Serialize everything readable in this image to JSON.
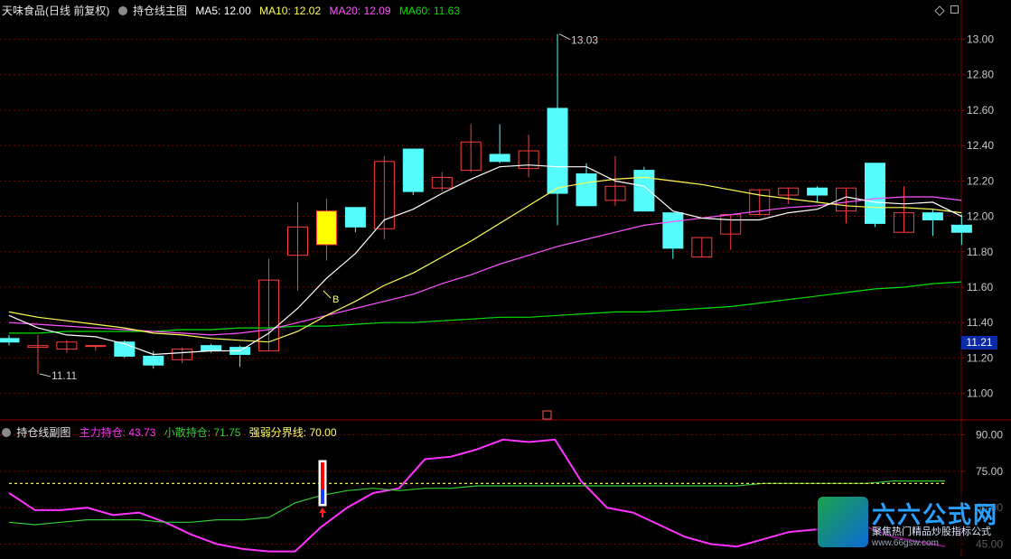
{
  "main_header": {
    "stock_name": "天味食品(日线 前复权)",
    "indicator_name": "持仓线主图",
    "ma5": "MA5: 12.00",
    "ma10": "MA10: 12.02",
    "ma20": "MA20: 12.09",
    "ma60": "MA60: 11.63"
  },
  "sub_header": {
    "indicator_name": "持仓线副图",
    "main_holding": "主力持仓: 43.73",
    "retail_holding": "小散持仓: 71.75",
    "boundary": "强弱分界线: 70.00"
  },
  "colors": {
    "up": "#ff3c3c",
    "down": "#54fcfc",
    "ma5": "#ffffff",
    "ma10": "#ffff54",
    "ma20": "#ff54ff",
    "ma60": "#00e000",
    "grid": "#7a0000",
    "axis_text": "#c8c8c8",
    "main_holding_line": "#ff33ff",
    "retail_holding_line": "#33cc33",
    "boundary_line": "#ffff66"
  },
  "price_axis": {
    "ticks": [
      "13.00",
      "12.80",
      "12.60",
      "12.40",
      "12.20",
      "12.00",
      "11.80",
      "11.60",
      "11.40",
      "11.20",
      "11.00"
    ],
    "current_price": "11.21"
  },
  "sub_axis": {
    "ticks": [
      "90.00",
      "75.00",
      "60.00",
      "45.00"
    ]
  },
  "annotations": {
    "high_label": "13.03",
    "low_label": "11.11",
    "buy_signal": "B"
  },
  "watermark": {
    "title": "六六公式网",
    "subtitle": "聚焦热门精品炒股指标公式",
    "url": "www.66gsw.com"
  },
  "chart_data": [
    {
      "type": "candlestick",
      "title": "持仓线主图",
      "ylim": [
        10.85,
        13.12
      ],
      "candles": [
        {
          "o": 11.31,
          "h": 11.33,
          "l": 11.27,
          "c": 11.29
        },
        {
          "o": 11.26,
          "h": 11.33,
          "l": 11.11,
          "c": 11.27
        },
        {
          "o": 11.25,
          "h": 11.3,
          "l": 11.23,
          "c": 11.29
        },
        {
          "o": 11.27,
          "h": 11.27,
          "l": 11.24,
          "c": 11.27
        },
        {
          "o": 11.29,
          "h": 11.3,
          "l": 11.2,
          "c": 11.21
        },
        {
          "o": 11.21,
          "h": 11.24,
          "l": 11.14,
          "c": 11.16
        },
        {
          "o": 11.19,
          "h": 11.26,
          "l": 11.17,
          "c": 11.25
        },
        {
          "o": 11.27,
          "h": 11.28,
          "l": 11.23,
          "c": 11.24
        },
        {
          "o": 11.26,
          "h": 11.27,
          "l": 11.15,
          "c": 11.22
        },
        {
          "o": 11.24,
          "h": 11.76,
          "l": 11.24,
          "c": 11.64
        },
        {
          "o": 11.78,
          "h": 12.08,
          "l": 11.58,
          "c": 11.94
        },
        {
          "o": 11.84,
          "h": 12.1,
          "l": 11.75,
          "c": 12.03
        },
        {
          "o": 12.05,
          "h": 12.05,
          "l": 11.91,
          "c": 11.94
        },
        {
          "o": 11.93,
          "h": 12.34,
          "l": 11.87,
          "c": 12.31
        },
        {
          "o": 12.38,
          "h": 12.38,
          "l": 12.12,
          "c": 12.14
        },
        {
          "o": 12.16,
          "h": 12.25,
          "l": 12.14,
          "c": 12.22
        },
        {
          "o": 12.26,
          "h": 12.52,
          "l": 12.25,
          "c": 12.42
        },
        {
          "o": 12.35,
          "h": 12.52,
          "l": 12.3,
          "c": 12.31
        },
        {
          "o": 12.27,
          "h": 12.46,
          "l": 12.22,
          "c": 12.37
        },
        {
          "o": 12.61,
          "h": 13.03,
          "l": 11.95,
          "c": 12.13
        },
        {
          "o": 12.24,
          "h": 12.3,
          "l": 12.06,
          "c": 12.06
        },
        {
          "o": 12.09,
          "h": 12.34,
          "l": 12.06,
          "c": 12.17
        },
        {
          "o": 12.26,
          "h": 12.28,
          "l": 12.03,
          "c": 12.03
        },
        {
          "o": 12.02,
          "h": 12.02,
          "l": 11.76,
          "c": 11.82
        },
        {
          "o": 11.77,
          "h": 11.88,
          "l": 11.77,
          "c": 11.88
        },
        {
          "o": 11.9,
          "h": 12.01,
          "l": 11.81,
          "c": 12.01
        },
        {
          "o": 12.01,
          "h": 12.15,
          "l": 12.01,
          "c": 12.15
        },
        {
          "o": 12.12,
          "h": 12.16,
          "l": 12.07,
          "c": 12.16
        },
        {
          "o": 12.16,
          "h": 12.17,
          "l": 12.08,
          "c": 12.12
        },
        {
          "o": 12.03,
          "h": 12.16,
          "l": 11.96,
          "c": 12.16
        },
        {
          "o": 12.3,
          "h": 12.3,
          "l": 11.94,
          "c": 11.96
        },
        {
          "o": 11.91,
          "h": 12.17,
          "l": 11.91,
          "c": 12.02
        },
        {
          "o": 12.02,
          "h": 12.04,
          "l": 11.89,
          "c": 11.98
        },
        {
          "o": 11.95,
          "h": 12.01,
          "l": 11.84,
          "c": 11.91
        }
      ],
      "ma5": [
        11.44,
        11.37,
        11.33,
        11.32,
        11.28,
        11.22,
        11.23,
        11.24,
        11.24,
        11.34,
        11.48,
        11.65,
        11.79,
        11.98,
        12.04,
        12.13,
        12.21,
        12.28,
        12.29,
        12.28,
        12.28,
        12.2,
        12.17,
        12.03,
        11.99,
        11.98,
        11.98,
        12.02,
        12.04,
        12.11,
        12.08,
        12.07,
        12.08,
        12.0
      ],
      "ma10": [
        11.46,
        11.43,
        11.41,
        11.39,
        11.37,
        11.34,
        11.33,
        11.31,
        11.3,
        11.29,
        11.35,
        11.44,
        11.52,
        11.61,
        11.68,
        11.77,
        11.86,
        11.96,
        12.06,
        12.16,
        12.19,
        12.21,
        12.22,
        12.2,
        12.18,
        12.15,
        12.12,
        12.1,
        12.08,
        12.06,
        12.05,
        12.05,
        12.04,
        12.02
      ],
      "ma20": [
        11.4,
        11.39,
        11.38,
        11.37,
        11.36,
        11.35,
        11.34,
        11.33,
        11.34,
        11.36,
        11.4,
        11.44,
        11.48,
        11.52,
        11.56,
        11.62,
        11.67,
        11.73,
        11.78,
        11.83,
        11.87,
        11.91,
        11.95,
        11.97,
        11.99,
        12.01,
        12.03,
        12.05,
        12.06,
        12.08,
        12.1,
        12.11,
        12.11,
        12.09
      ],
      "ma60": [
        11.34,
        11.34,
        11.35,
        11.35,
        11.35,
        11.35,
        11.36,
        11.36,
        11.37,
        11.37,
        11.38,
        11.38,
        11.39,
        11.4,
        11.4,
        11.41,
        11.42,
        11.43,
        11.43,
        11.44,
        11.45,
        11.46,
        11.46,
        11.47,
        11.48,
        11.49,
        11.51,
        11.53,
        11.55,
        11.57,
        11.59,
        11.6,
        11.62,
        11.63
      ]
    },
    {
      "type": "line",
      "title": "持仓线副图",
      "ylim": [
        40,
        95
      ],
      "series": [
        {
          "name": "主力持仓",
          "values": [
            66,
            59,
            59,
            60,
            57,
            58,
            54,
            49,
            45,
            43,
            42,
            42,
            52,
            60,
            66,
            68,
            80,
            81,
            84,
            88,
            87,
            88,
            71,
            60,
            58,
            53,
            48,
            45,
            44,
            47,
            50,
            51,
            51,
            52,
            48,
            46,
            44
          ]
        },
        {
          "name": "小散持仓",
          "values": [
            54,
            53,
            54,
            55,
            55,
            55,
            54,
            54,
            55,
            55,
            56,
            62,
            65,
            67,
            68,
            67,
            68,
            68,
            69,
            69,
            69,
            69,
            69,
            69,
            69,
            69,
            69,
            69,
            69,
            70,
            70,
            70,
            70,
            70,
            71,
            71,
            71
          ]
        },
        {
          "name": "强弱分界线",
          "values": [
            70,
            70,
            70,
            70,
            70,
            70,
            70,
            70,
            70,
            70,
            70,
            70,
            70,
            70,
            70,
            70,
            70,
            70,
            70,
            70,
            70,
            70,
            70,
            70,
            70,
            70,
            70,
            70,
            70,
            70,
            70,
            70,
            70,
            70,
            70,
            70,
            70
          ]
        }
      ]
    }
  ]
}
